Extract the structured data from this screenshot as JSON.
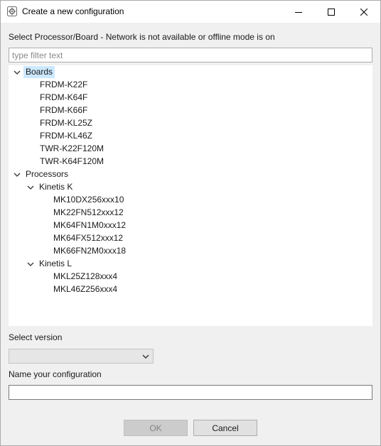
{
  "window": {
    "title": "Create a new configuration"
  },
  "selection": {
    "label": "Select Processor/Board - Network is not available or offline mode is on",
    "filter_placeholder": "type filter text",
    "filter_value": ""
  },
  "tree": {
    "boards": {
      "label": "Boards",
      "items": [
        "FRDM-K22F",
        "FRDM-K64F",
        "FRDM-K66F",
        "FRDM-KL25Z",
        "FRDM-KL46Z",
        "TWR-K22F120M",
        "TWR-K64F120M"
      ]
    },
    "processors": {
      "label": "Processors",
      "kinetis_k": {
        "label": "Kinetis K",
        "items": [
          "MK10DX256xxx10",
          "MK22FN512xxx12",
          "MK64FN1M0xxx12",
          "MK64FX512xxx12",
          "MK66FN2M0xxx18"
        ]
      },
      "kinetis_l": {
        "label": "Kinetis L",
        "items": [
          "MKL25Z128xxx4",
          "MKL46Z256xxx4"
        ]
      }
    }
  },
  "version": {
    "label": "Select version",
    "value": ""
  },
  "name": {
    "label": "Name your configuration",
    "value": ""
  },
  "buttons": {
    "ok": "OK",
    "cancel": "Cancel"
  },
  "colors": {
    "selection_highlight": "#cce8ff",
    "dialog_background": "#f0f0f0",
    "disabled_button": "#cccccc"
  },
  "icons": [
    "app-icon",
    "minimize-icon",
    "maximize-icon",
    "close-icon",
    "chevron-down-icon"
  ]
}
